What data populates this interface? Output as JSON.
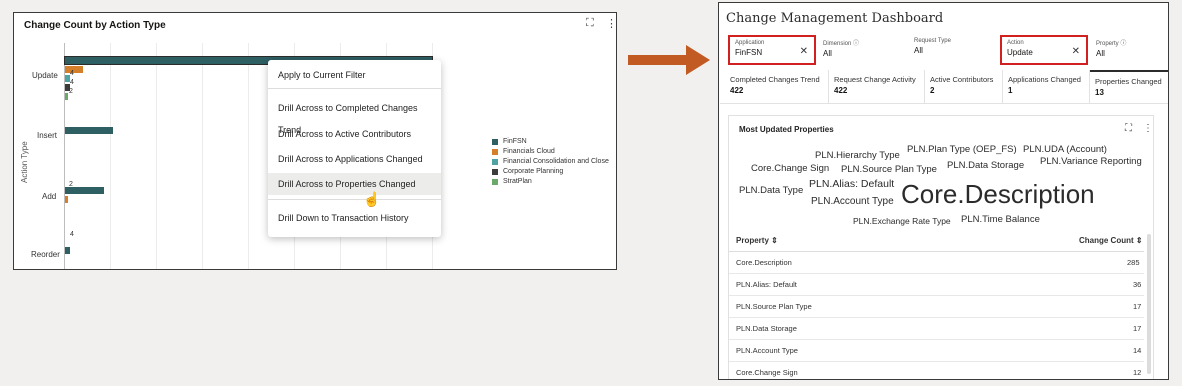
{
  "left_chart": {
    "title": "Change Count by Action Type",
    "expand_icon": "expand-icon",
    "more_icon": "more-vertical-icon",
    "y_axis_title": "Action Type",
    "categories": [
      "Update",
      "Insert",
      "Add",
      "Reorder"
    ],
    "value_labels": {
      "update_financials": "4",
      "update_fcc": "4",
      "update_corporate": "2",
      "add_financials": "2",
      "reorder_finfsn": "4"
    },
    "legend": [
      {
        "name": "FinFSN",
        "color": "#2d5f63"
      },
      {
        "name": "Financials Cloud",
        "color": "#d67f2b"
      },
      {
        "name": "Financial Consolidation and Close",
        "color": "#4fa3a5"
      },
      {
        "name": "Corporate Planning",
        "color": "#3b3b3b"
      },
      {
        "name": "StratPlan",
        "color": "#6aa96a"
      }
    ],
    "context_menu": [
      "Apply to Current Filter",
      "Drill Across to Completed Changes Trend",
      "Drill Across to Active Contributors",
      "Drill Across to Applications Changed",
      "Drill Across to Properties Changed",
      "Drill Down to Transaction History"
    ]
  },
  "dashboard": {
    "title": "Change Management Dashboard",
    "filters": [
      {
        "label": "Application",
        "value": "FinFSN"
      },
      {
        "label": "Dimension",
        "value": "All"
      },
      {
        "label": "Request Type",
        "value": "All"
      },
      {
        "label": "Action",
        "value": "Update"
      },
      {
        "label": "Property",
        "value": "All"
      }
    ],
    "kpis": [
      {
        "label": "Completed Changes Trend",
        "value": "422"
      },
      {
        "label": "Request Change Activity",
        "value": "422"
      },
      {
        "label": "Active Contributors",
        "value": "2"
      },
      {
        "label": "Applications Changed",
        "value": "1"
      },
      {
        "label": "Properties Changed",
        "value": "13"
      }
    ],
    "card": {
      "title": "Most Updated Properties",
      "word_cloud": [
        "PLN.Hierarchy Type",
        "PLN.Plan Type (OEP_FS)",
        "PLN.UDA (Account)",
        "Core.Change Sign",
        "PLN.Source Plan Type",
        "PLN.Data Storage",
        "PLN.Variance Reporting",
        "PLN.Data Type",
        "PLN.Alias: Default",
        "Core.Description",
        "PLN.Account Type",
        "PLN.Exchange Rate Type",
        "PLN.Time Balance"
      ],
      "table": {
        "col_property": "Property",
        "col_count": "Change Count",
        "rows": [
          {
            "property": "Core.Description",
            "count": "285"
          },
          {
            "property": "PLN.Alias: Default",
            "count": "36"
          },
          {
            "property": "PLN.Source Plan Type",
            "count": "17"
          },
          {
            "property": "PLN.Data Storage",
            "count": "17"
          },
          {
            "property": "PLN.Account Type",
            "count": "14"
          },
          {
            "property": "Core.Change Sign",
            "count": "12"
          }
        ]
      }
    }
  },
  "chart_data": {
    "type": "bar",
    "title": "Change Count by Action Type",
    "ylabel": "Action Type",
    "categories": [
      "Update",
      "Insert",
      "Add",
      "Reorder"
    ],
    "series": [
      {
        "name": "FinFSN",
        "values": [
          285,
          37,
          30,
          4
        ]
      },
      {
        "name": "Financials Cloud",
        "values": [
          14,
          0,
          2,
          0
        ]
      },
      {
        "name": "Financial Consolidation and Close",
        "values": [
          4,
          0,
          0,
          0
        ]
      },
      {
        "name": "Corporate Planning",
        "values": [
          4,
          0,
          0,
          0
        ]
      },
      {
        "name": "StratPlan",
        "values": [
          2,
          0,
          0,
          0
        ]
      }
    ],
    "xlim": [
      0,
      300
    ],
    "grid": true,
    "legend": "right"
  }
}
